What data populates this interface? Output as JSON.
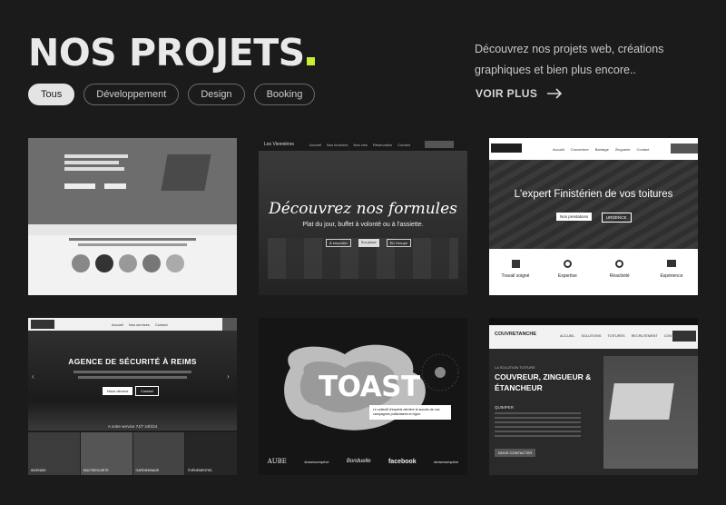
{
  "header": {
    "title": "NOS PROJETS",
    "intro": "Découvrez nos projets web, créations graphiques et bien plus encore..",
    "more_label": "VOIR PLUS",
    "accent": "#c8f031"
  },
  "filters": [
    "Tous",
    "Développement",
    "Design",
    "Booking"
  ],
  "projects": {
    "p1": {
      "people_count": 5
    },
    "p2": {
      "brand": "Les Viennières",
      "nav": [
        "Accueil",
        "Nos formules",
        "Nos vins",
        "Réservation",
        "Contact"
      ],
      "headline": "Découvrez nos formules",
      "sub": "Plat du jour, buffet à volonté ou à l'assiette.",
      "buttons": [
        "À emporter",
        "Sur place",
        "En Groupe"
      ]
    },
    "p3": {
      "nav": [
        "Accueil",
        "Couverture",
        "Bardage",
        "Zinguerie",
        "Contact"
      ],
      "headline": "L'expert Finistérien de vos toitures",
      "buttons": [
        "Nos prestations",
        "URGENCE"
      ],
      "features": [
        "Travail soigné",
        "Expertise",
        "Réactivité",
        "Expérience"
      ]
    },
    "p4": {
      "nav": [
        "Accueil",
        "Nos services",
        "Contact"
      ],
      "headline": "AGENCE DE SÉCURITÉ À REIMS",
      "buttons": [
        "Nous devons",
        "Contact"
      ],
      "hotline": "A votre service 7J/7 24h/24",
      "services": [
        "INCENDIE",
        "MULTISECURITE",
        "GARDIENNAGE",
        "ÉVÉNEMENTIEL"
      ]
    },
    "p5": {
      "headline": "TOAST",
      "tagline": "Le collectif d'experts derrière le succès de vos campagnes publicitaires en ligne.",
      "logos": [
        "AUBE",
        "showroomprive",
        "Bonduelle",
        "facebook",
        "showroomprive"
      ]
    },
    "p6": {
      "brand": "COUVRETANCHE",
      "nav": [
        "ACCUEIL",
        "SOLUTIONS",
        "TOITURES",
        "RECRUTEMENT",
        "CONTACT"
      ],
      "kicker": "LA SOLUTION TOITURE",
      "headline": "COUVREUR, ZINGUEUR & ÉTANCHEUR",
      "city": "QUIMPER",
      "cta": "NOUS CONTACTER"
    }
  }
}
